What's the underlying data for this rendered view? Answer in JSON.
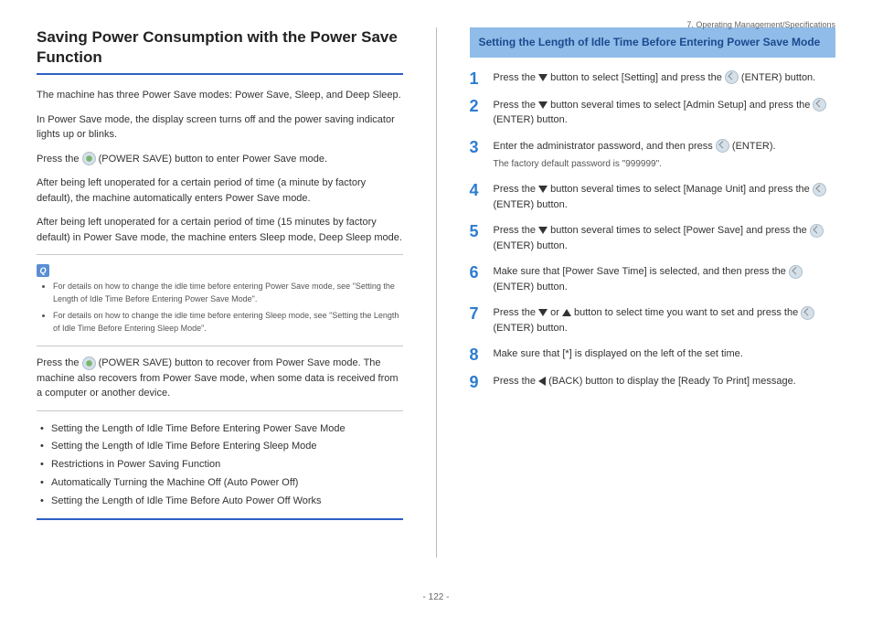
{
  "header_path": "7. Operating Management/Specifications",
  "left": {
    "title": "Saving Power Consumption with the Power Save Function",
    "p1": "The machine has three Power Save modes: Power Save, Sleep, and Deep Sleep.",
    "p2": "In Power Save mode, the display screen turns off and the power saving indicator lights up or blinks.",
    "p3a": "Press the ",
    "p3b": " (POWER SAVE) button to enter Power Save mode.",
    "p4": "After being left unoperated for a certain period of time (a minute by factory default), the machine automatically enters Power Save mode.",
    "p5": "After being left unoperated for a certain period of time (15 minutes by factory default) in Power Save mode, the machine enters Sleep mode, Deep Sleep mode.",
    "note1": "For details on how to change the idle time before entering Power Save mode, see \"Setting the Length of Idle Time Before Entering Power Save Mode\".",
    "note2": "For details on how to change the idle time before entering Sleep mode, see \"Setting the Length of Idle Time Before Entering Sleep Mode\".",
    "p6a": "Press the ",
    "p6b": " (POWER SAVE) button to recover from Power Save mode. The machine also recovers from Power Save mode, when some data is received from a computer or another device.",
    "toc": [
      "Setting the Length of Idle Time Before Entering Power Save Mode",
      "Setting the Length of Idle Time Before Entering Sleep Mode",
      "Restrictions in Power Saving Function",
      "Automatically Turning the Machine Off (Auto Power Off)",
      "Setting the Length of Idle Time Before Auto Power Off Works"
    ]
  },
  "right": {
    "section_title": "Setting the Length of Idle Time Before Entering Power Save Mode",
    "steps": [
      {
        "n": "1",
        "pre": "Press the ",
        "mid": " button to select [Setting] and press the ",
        "post": " (ENTER) button.",
        "icons": [
          "down",
          "enter"
        ]
      },
      {
        "n": "2",
        "pre": "Press the ",
        "mid": " button several times to select [Admin Setup] and press the ",
        "post": " (ENTER) button.",
        "icons": [
          "down",
          "enter"
        ]
      },
      {
        "n": "3",
        "pre": "Enter the administrator password, and then press ",
        "mid": "",
        "post": " (ENTER).",
        "icons": [
          "enter"
        ],
        "sub": "The factory default password is \"999999\"."
      },
      {
        "n": "4",
        "pre": "Press the ",
        "mid": " button several times to select [Manage Unit] and press the ",
        "post": " (ENTER) button.",
        "icons": [
          "down",
          "enter"
        ]
      },
      {
        "n": "5",
        "pre": "Press the ",
        "mid": " button several times to select [Power Save] and press the ",
        "post": " (ENTER) button.",
        "icons": [
          "down",
          "enter"
        ]
      },
      {
        "n": "6",
        "pre": "Make sure that [Power Save Time] is selected, and then press the ",
        "mid": "",
        "post": " (ENTER) button.",
        "icons": [
          "enter"
        ]
      },
      {
        "n": "7",
        "pre": "Press the ",
        "mid": " or ",
        "mid2": " button to select time you want to set and press the ",
        "post": " (ENTER) button.",
        "icons": [
          "down",
          "up",
          "enter"
        ]
      },
      {
        "n": "8",
        "pre": "Make sure that [*] is displayed on the left of the set time.",
        "mid": "",
        "post": "",
        "icons": []
      },
      {
        "n": "9",
        "pre": "Press the ",
        "mid": " (BACK) button to display the [Ready To Print] message.",
        "post": "",
        "icons": [
          "left"
        ]
      }
    ]
  },
  "page_number": "- 122 -"
}
